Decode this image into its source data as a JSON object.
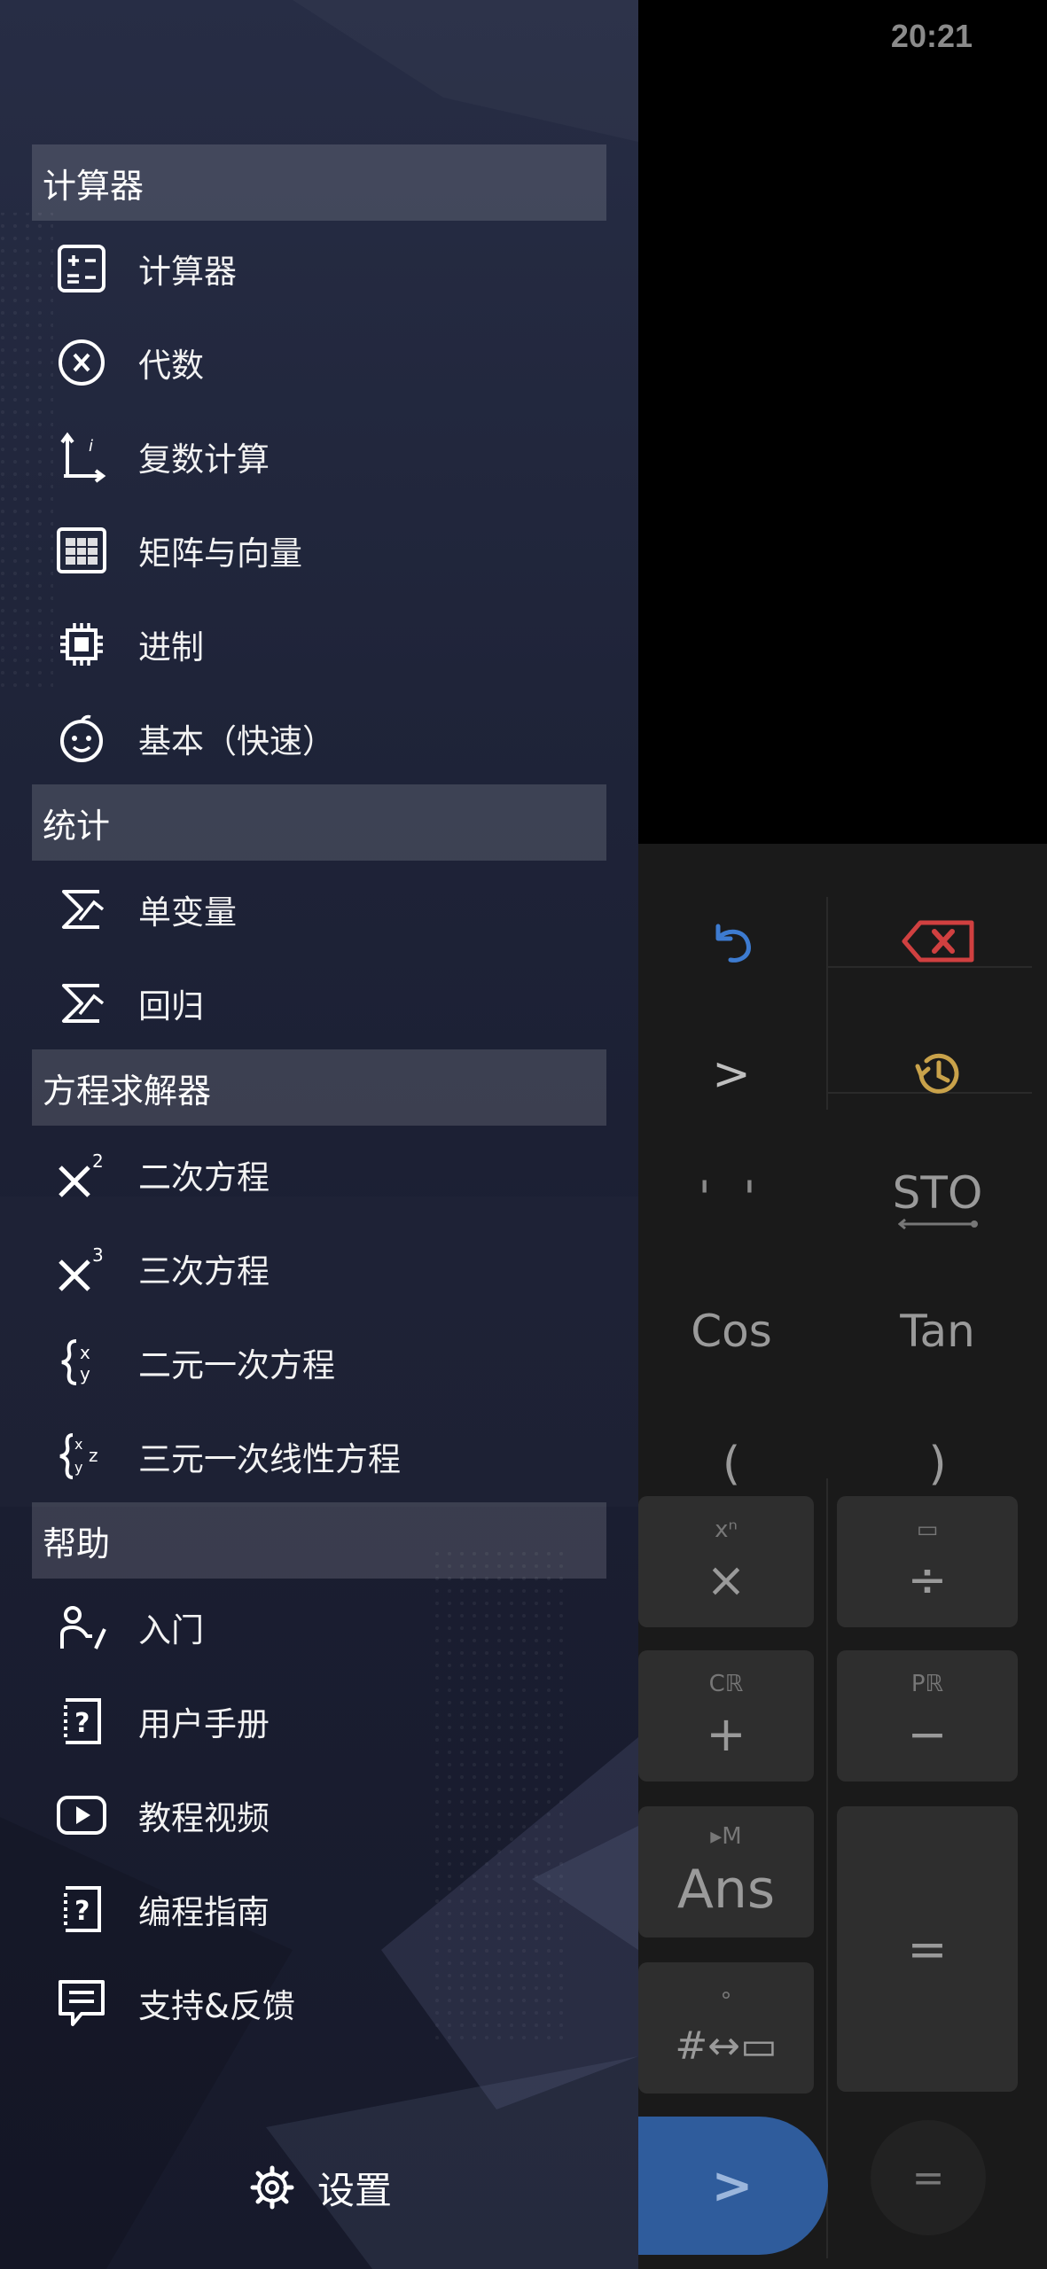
{
  "status_bar": {
    "time": "20:21"
  },
  "drawer": {
    "sections": [
      {
        "title": "计算器",
        "items": [
          {
            "label": "计算器",
            "icon": "calculator-icon"
          },
          {
            "label": "代数",
            "icon": "algebra-x-icon"
          },
          {
            "label": "复数计算",
            "icon": "complex-axis-icon"
          },
          {
            "label": "矩阵与向量",
            "icon": "matrix-icon"
          },
          {
            "label": "进制",
            "icon": "chip-icon"
          },
          {
            "label": "基本（快速）",
            "icon": "smiley-icon"
          }
        ]
      },
      {
        "title": "统计",
        "items": [
          {
            "label": "单变量",
            "icon": "sigma-icon"
          },
          {
            "label": "回归",
            "icon": "sigma-icon"
          }
        ]
      },
      {
        "title": "方程求解器",
        "items": [
          {
            "label": "二次方程",
            "icon": "x-squared-icon"
          },
          {
            "label": "三次方程",
            "icon": "x-cubed-icon"
          },
          {
            "label": "二元一次方程",
            "icon": "brace-xy-icon"
          },
          {
            "label": "三元一次线性方程",
            "icon": "brace-xyz-icon"
          }
        ]
      },
      {
        "title": "帮助",
        "items": [
          {
            "label": "入门",
            "icon": "person-pointer-icon"
          },
          {
            "label": "用户手册",
            "icon": "help-document-icon"
          },
          {
            "label": "教程视频",
            "icon": "play-video-icon"
          },
          {
            "label": "编程指南",
            "icon": "help-document-icon"
          },
          {
            "label": "支持&反馈",
            "icon": "feedback-message-icon"
          }
        ]
      }
    ],
    "settings": {
      "label": "设置",
      "icon": "gear-icon"
    }
  },
  "calculator": {
    "keys": {
      "undo": "undo-icon",
      "backspace": "backspace-icon",
      "cursor_right": ">",
      "history": "history-icon",
      "comma_pair": "' '",
      "sto": "STO",
      "cos": "Cos",
      "tan": "Tan",
      "paren_open": "(",
      "paren_close": ")",
      "multiply": "×",
      "multiply_shift": "xⁿ",
      "divide": "÷",
      "divide_shift": "▭",
      "plus": "+",
      "plus_shift": "Cℝ",
      "minus": "−",
      "minus_shift": "Pℝ",
      "ans": "Ans",
      "ans_shift": "▸M",
      "convert": "#↔▭",
      "convert_shift": "°",
      "equals": "=",
      "execute": ">",
      "equals_round": "="
    },
    "colors": {
      "accent_blue": "#3d7bd0",
      "backspace_red": "#d04040",
      "history_gold": "#c9a24a",
      "execute_bg": "#2f5c9c"
    }
  }
}
